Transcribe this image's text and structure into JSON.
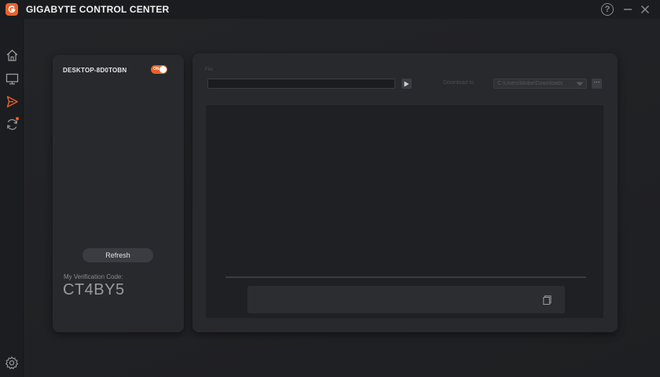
{
  "app": {
    "title": "GIGABYTE CONTROL CENTER"
  },
  "titlebar": {
    "help_label": "?",
    "icons": [
      "help-icon",
      "minimize-icon",
      "close-icon"
    ]
  },
  "sidebar": {
    "items": [
      {
        "id": "home",
        "icon": "home-icon"
      },
      {
        "id": "monitor",
        "icon": "monitor-icon"
      },
      {
        "id": "share",
        "icon": "share-icon",
        "active": true
      },
      {
        "id": "update",
        "icon": "update-icon",
        "notification": true
      }
    ],
    "settings_icon": "gear-icon"
  },
  "device_panel": {
    "device_name": "DESKTOP-8D0TOBN",
    "toggle_label": "ON",
    "refresh_label": "Refresh",
    "verification_label": "My Verification Code:",
    "verification_code": "CT4BY5"
  },
  "transfer_panel": {
    "file_label": "File",
    "file_value": "",
    "download_label": "Download to",
    "download_path": "C:\\Users\\Mobe\\Downloads",
    "more_label": "···"
  },
  "colors": {
    "accent": "#e8622a",
    "background": "#202124",
    "card": "#27292d"
  }
}
